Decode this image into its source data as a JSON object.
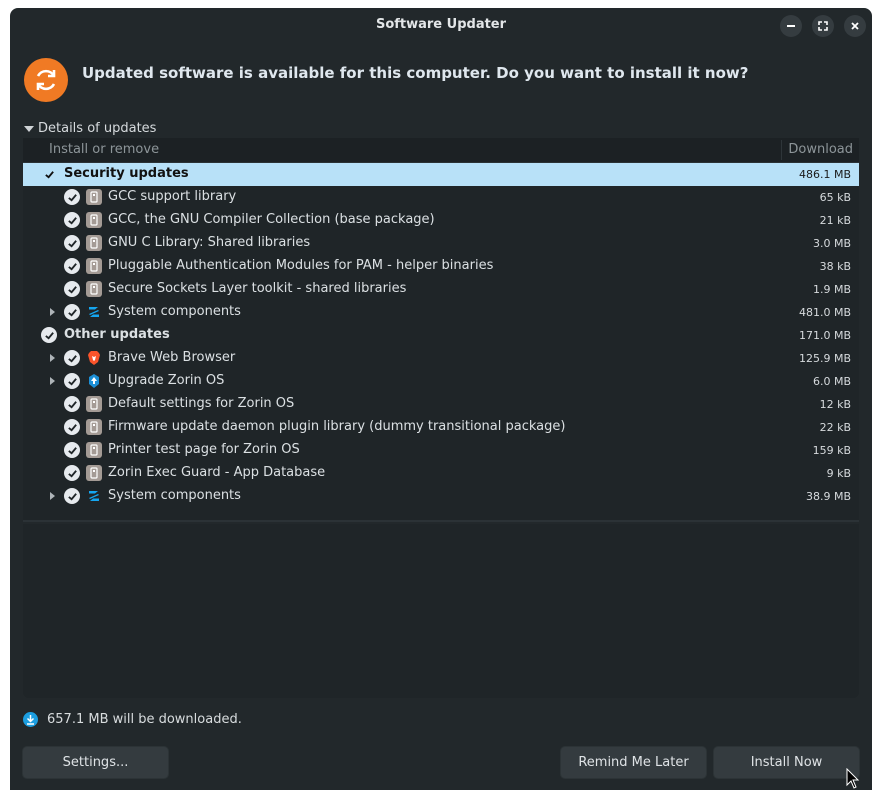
{
  "window": {
    "title": "Software Updater"
  },
  "headline": "Updated software is available for this computer. Do you want to install it now?",
  "details_label": "Details of updates",
  "columns": {
    "install": "Install or remove",
    "download": "Download"
  },
  "groups": [
    {
      "label": "Security updates",
      "size": "486.1 MB",
      "items": [
        {
          "label": "GCC support library",
          "size": "65 kB",
          "icon": "package-icon",
          "expandable": false
        },
        {
          "label": "GCC, the GNU Compiler Collection (base package)",
          "size": "21 kB",
          "icon": "package-icon",
          "expandable": false
        },
        {
          "label": "GNU C Library: Shared libraries",
          "size": "3.0 MB",
          "icon": "package-icon",
          "expandable": false
        },
        {
          "label": "Pluggable Authentication Modules for PAM - helper binaries",
          "size": "38 kB",
          "icon": "package-icon",
          "expandable": false
        },
        {
          "label": "Secure Sockets Layer toolkit - shared libraries",
          "size": "1.9 MB",
          "icon": "package-icon",
          "expandable": false
        },
        {
          "label": "System components",
          "size": "481.0 MB",
          "icon": "zorin-icon",
          "expandable": true
        }
      ]
    },
    {
      "label": "Other updates",
      "size": "171.0 MB",
      "items": [
        {
          "label": "Brave Web Browser",
          "size": "125.9 MB",
          "icon": "brave-icon",
          "expandable": true
        },
        {
          "label": "Upgrade Zorin OS",
          "size": "6.0 MB",
          "icon": "upgrade-icon",
          "expandable": true
        },
        {
          "label": "Default settings for Zorin OS",
          "size": "12 kB",
          "icon": "package-icon",
          "expandable": false
        },
        {
          "label": "Firmware update daemon plugin library (dummy transitional package)",
          "size": "22 kB",
          "icon": "package-icon",
          "expandable": false
        },
        {
          "label": "Printer test page for Zorin OS",
          "size": "159 kB",
          "icon": "package-icon",
          "expandable": false
        },
        {
          "label": "Zorin Exec Guard - App Database",
          "size": "9 kB",
          "icon": "package-icon",
          "expandable": false
        },
        {
          "label": "System components",
          "size": "38.9 MB",
          "icon": "zorin-icon",
          "expandable": true
        }
      ]
    }
  ],
  "download_info": "657.1 MB will be downloaded.",
  "buttons": {
    "settings": "Settings...",
    "remind": "Remind Me Later",
    "install": "Install Now"
  },
  "colors": {
    "accent": "#1c9ee0",
    "selection": "#b8e1f8",
    "window_bg": "#22282b",
    "update_icon": "#f07a24"
  }
}
